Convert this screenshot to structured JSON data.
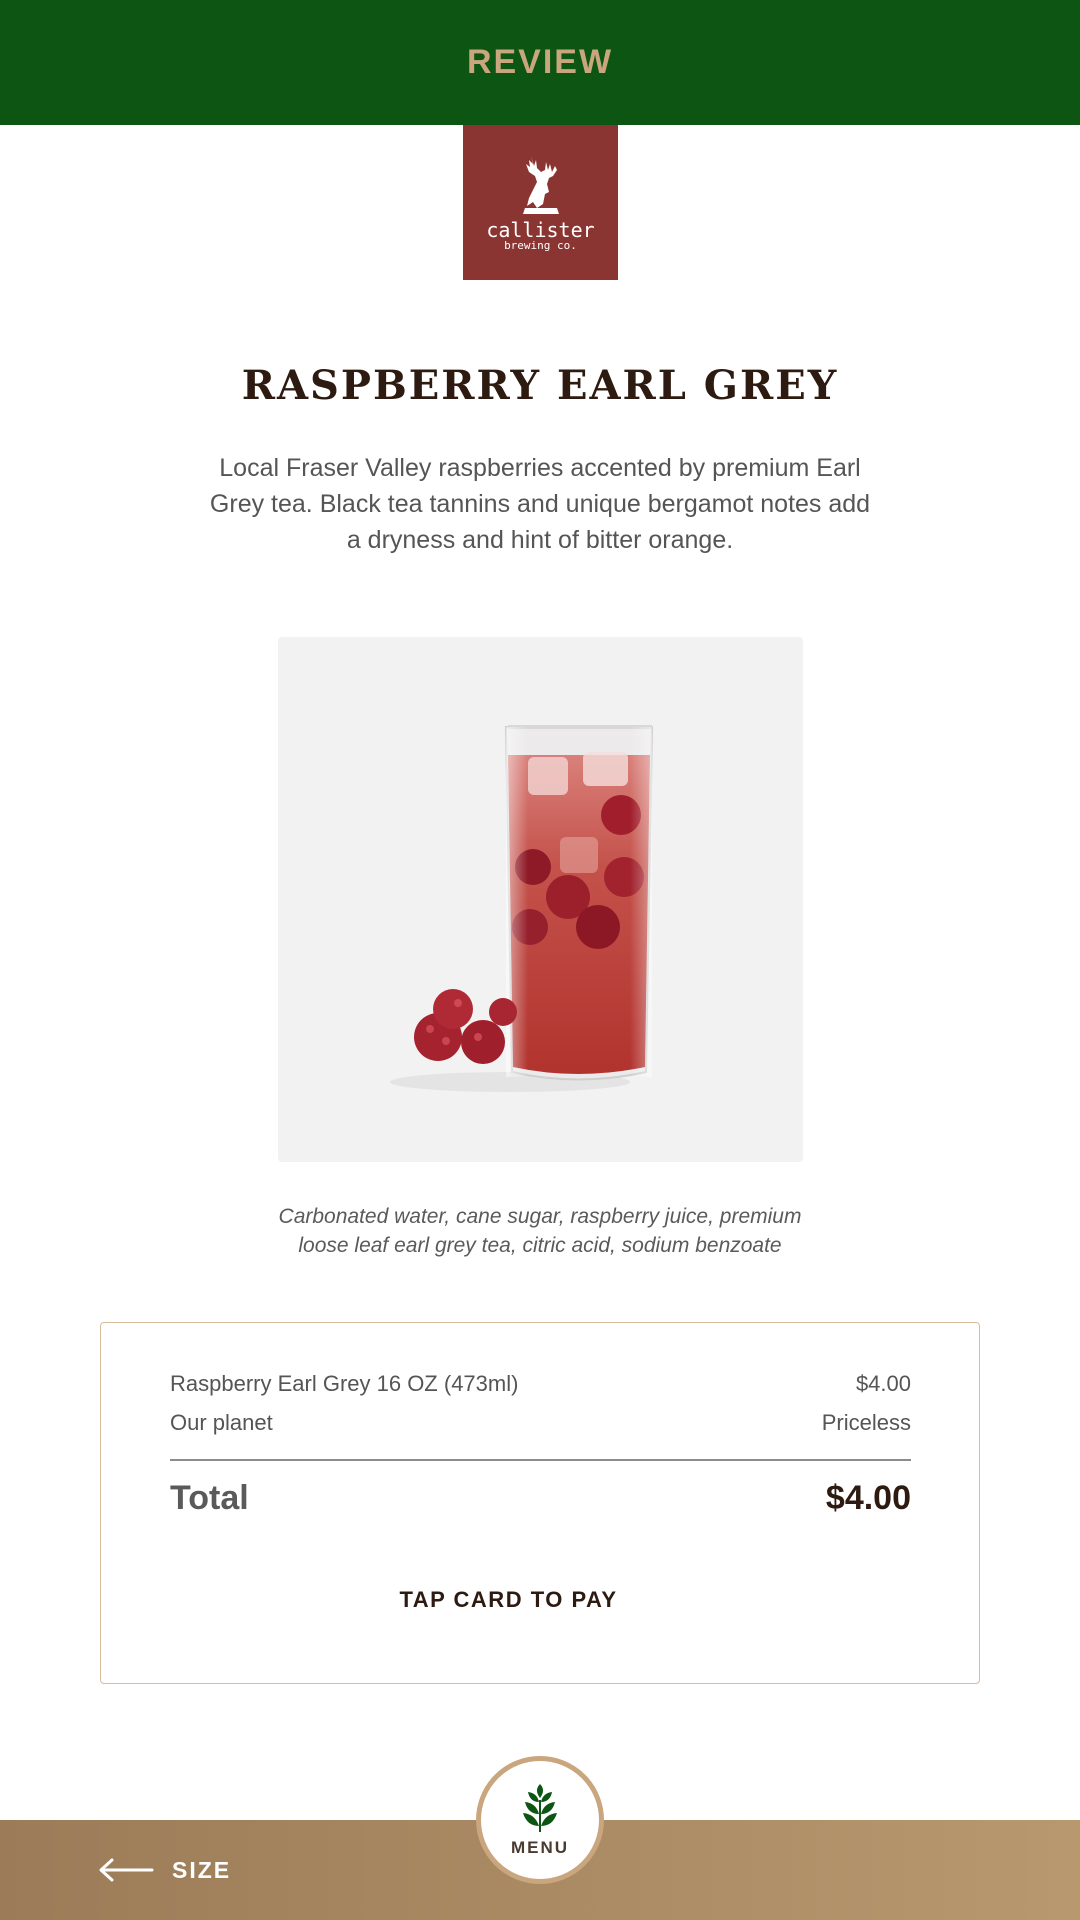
{
  "header": {
    "title": "REVIEW",
    "bg_color": "#0c5512",
    "title_color": "#c9a67d"
  },
  "logo": {
    "name": "callister",
    "sub": "brewing co.",
    "bg_color": "#8a3531",
    "icon": "stag-head-icon"
  },
  "product": {
    "title": "RASPBERRY EARL GREY",
    "description": "Local Fraser Valley raspberries accented by premium Earl Grey tea. Black tea tannins and unique bergamot notes add a dryness and hint of bitter orange.",
    "ingredients": "Carbonated water, cane sugar, raspberry juice, premium loose leaf earl grey tea, citric acid, sodium benzoate"
  },
  "order": {
    "items": [
      {
        "label": "Raspberry Earl Grey 16 OZ (473ml)",
        "price": "$4.00"
      },
      {
        "label": "Our planet",
        "price": "Priceless"
      }
    ],
    "total_label": "Total",
    "total_value": "$4.00",
    "pay_label": "TAP CARD TO PAY",
    "border_color": "#d9bca0"
  },
  "footer": {
    "back_label": "SIZE",
    "back_icon": "arrow-left-icon",
    "menu_label": "MENU",
    "menu_icon": "leaf-icon",
    "bar_color": "#b8986e"
  }
}
